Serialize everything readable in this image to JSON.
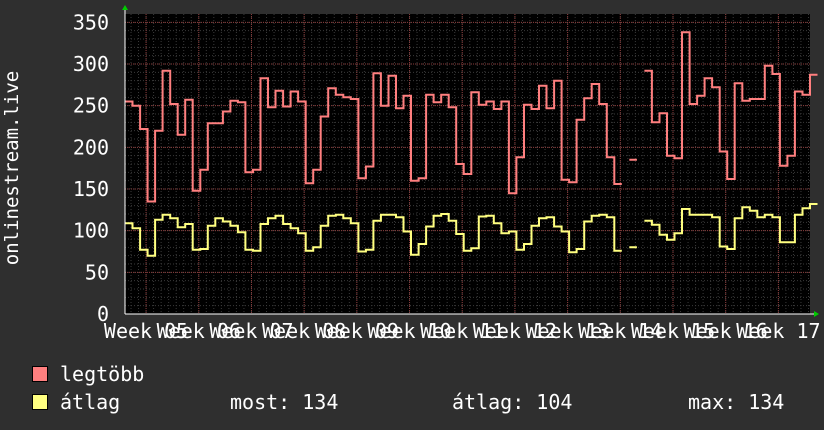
{
  "chart_data": {
    "type": "line",
    "ylabel": "onlinestream.live",
    "ylim": [
      0,
      360
    ],
    "yticks": [
      0,
      50,
      100,
      150,
      200,
      250,
      300,
      350
    ],
    "xticks": [
      "Week 05",
      "Week 06",
      "Week 07",
      "Week 08",
      "Week 09",
      "Week 10",
      "Week 11",
      "Week 12",
      "Week 13",
      "Week 14",
      "Week 15",
      "Week 16",
      "Week 17"
    ],
    "xrange": [
      4.6,
      17.6
    ],
    "grid": true,
    "step_days": 1,
    "series": [
      {
        "name": "legtöbb",
        "color": "#ff7f7f",
        "start_week": 4.6,
        "values": [
          255,
          250,
          222,
          135,
          220,
          292,
          252,
          215,
          257,
          148,
          173,
          229,
          229,
          243,
          256,
          254,
          170,
          173,
          283,
          248,
          268,
          249,
          267,
          255,
          157,
          173,
          237,
          271,
          263,
          260,
          258,
          163,
          177,
          289,
          250,
          286,
          247,
          262,
          160,
          163,
          263,
          254,
          263,
          248,
          180,
          168,
          266,
          251,
          255,
          246,
          255,
          145,
          188,
          251,
          246,
          274,
          247,
          280,
          161,
          158,
          233,
          259,
          276,
          252,
          188,
          156,
          null,
          185,
          null,
          292,
          230,
          241,
          190,
          187,
          338,
          252,
          262,
          283,
          272,
          195,
          162,
          277,
          256,
          258,
          258,
          298,
          288,
          178,
          190,
          267,
          263,
          287
        ]
      },
      {
        "name": "átlag",
        "color": "#ffff80",
        "start_week": 4.6,
        "values": [
          109,
          103,
          77,
          70,
          113,
          119,
          115,
          104,
          108,
          77,
          78,
          106,
          115,
          111,
          106,
          98,
          77,
          76,
          108,
          115,
          118,
          108,
          103,
          97,
          76,
          80,
          106,
          118,
          119,
          115,
          109,
          75,
          77,
          112,
          119,
          119,
          116,
          99,
          71,
          84,
          105,
          118,
          120,
          112,
          96,
          76,
          79,
          117,
          118,
          109,
          97,
          99,
          77,
          84,
          106,
          115,
          116,
          105,
          99,
          74,
          78,
          111,
          118,
          119,
          116,
          76,
          null,
          80,
          null,
          112,
          107,
          95,
          89,
          97,
          126,
          119,
          119,
          119,
          116,
          81,
          78,
          115,
          128,
          124,
          116,
          119,
          116,
          86,
          86,
          119,
          127,
          132
        ]
      }
    ]
  },
  "legend": [
    {
      "label": "legtöbb",
      "color": "#ff7f7f"
    },
    {
      "label": "átlag",
      "color": "#ffff80"
    }
  ],
  "stats": {
    "now": "most: 134",
    "avg": "átlag: 104",
    "max": "max: 134"
  }
}
